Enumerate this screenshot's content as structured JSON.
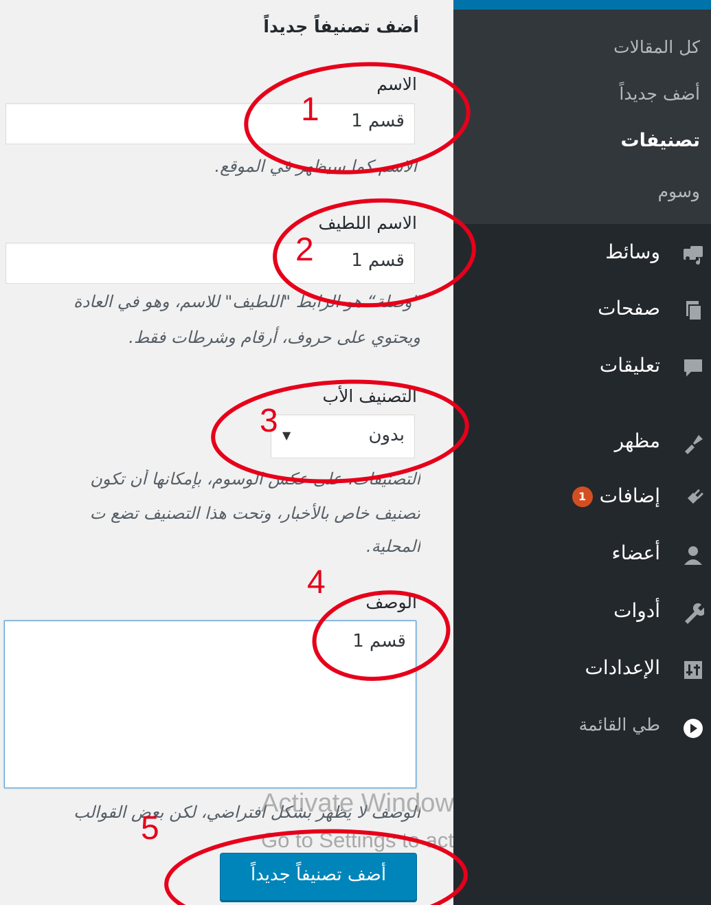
{
  "form": {
    "heading": "أضف تصنيفاً جديداً",
    "name": {
      "label": "الاسم",
      "value": "قسم 1",
      "hint": "الاسم كما سيظهر في الموقع."
    },
    "slug": {
      "label": "الاسم اللطيف",
      "value": "قسم 1",
      "hint_line1": "”وصلة“ هو الرابط \"اللطيف\" للاسم، وهو في العادة",
      "hint_line2": "ويحتوي على حروف، أرقام وشرطات فقط."
    },
    "parent": {
      "label": "التصنيف الأب",
      "selected": "بدون",
      "hint_line1": "التصنيفات، على عكس الوسوم، بإمكانها أن تكون",
      "hint_line2": "تصنيف خاص بالأخبار، وتحت هذا التصنيف تضع ت",
      "hint_line3": "المحلية."
    },
    "description": {
      "label": "الوصف",
      "value": "قسم 1",
      "hint": "الوصف لا يظهر بشكل افتراضي، لكن بعض القوالب"
    },
    "submit_label": "أضف تصنيفاً جديداً"
  },
  "sidebar": {
    "submenu": [
      "كل المقالات",
      "أضف جديداً",
      "تصنيفات",
      "وسوم"
    ],
    "current_submenu": "تصنيفات",
    "menu": [
      {
        "label": "وسائط",
        "icon": "media-icon"
      },
      {
        "label": "صفحات",
        "icon": "pages-icon"
      },
      {
        "label": "تعليقات",
        "icon": "comments-icon"
      },
      {
        "label": "مظهر",
        "icon": "appearance-icon"
      },
      {
        "label": "إضافات",
        "icon": "plugins-icon",
        "badge": "1"
      },
      {
        "label": "أعضاء",
        "icon": "users-icon"
      },
      {
        "label": "أدوات",
        "icon": "tools-icon"
      },
      {
        "label": "الإعدادات",
        "icon": "settings-icon"
      },
      {
        "label": "طي القائمة",
        "icon": "collapse-icon"
      }
    ]
  },
  "annotations": [
    "1",
    "2",
    "3",
    "4",
    "5"
  ],
  "watermark": {
    "line1": "Activate Windows",
    "line2": "Go to Settings to activate Windows."
  },
  "colors": {
    "sidebar": "#23282d",
    "submenu": "#32373c",
    "primary_button": "#0085ba",
    "annotation_red": "#e6001a",
    "badge": "#d54e21"
  }
}
